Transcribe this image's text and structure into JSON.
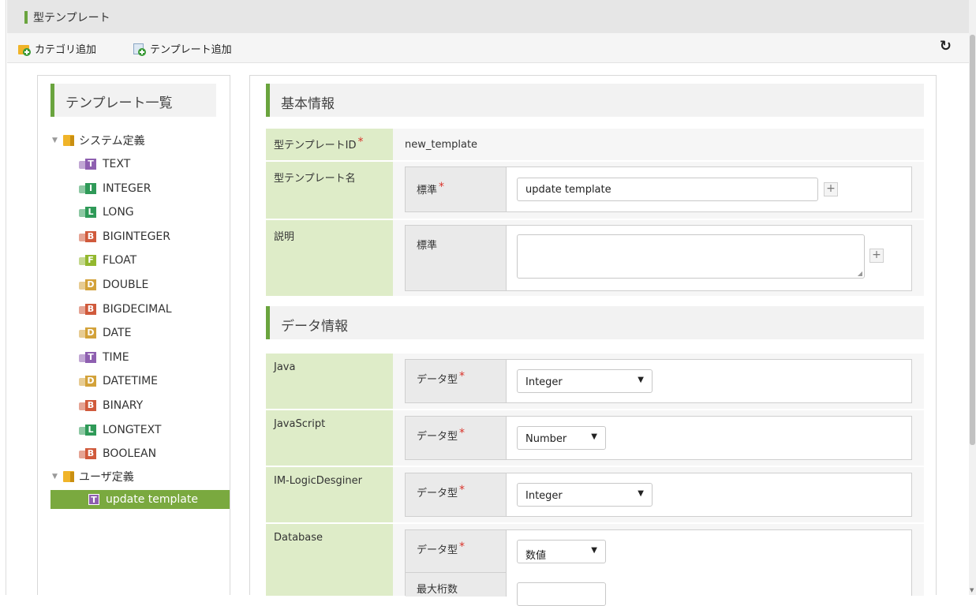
{
  "window": {
    "title": "型テンプレート"
  },
  "toolbar": {
    "add_category": "カテゴリ追加",
    "add_template": "テンプレート追加",
    "refresh_icon": "refresh-icon"
  },
  "tree": {
    "heading": "テンプレート一覧",
    "system_folder": "システム定義",
    "user_folder": "ユーザ定義",
    "items": [
      {
        "badge": "T",
        "label": "TEXT",
        "color": "#8e5fb0"
      },
      {
        "badge": "I",
        "label": "INTEGER",
        "color": "#2f9a58"
      },
      {
        "badge": "L",
        "label": "LONG",
        "color": "#2f9a58"
      },
      {
        "badge": "B",
        "label": "BIGINTEGER",
        "color": "#d05a3c"
      },
      {
        "badge": "F",
        "label": "FLOAT",
        "color": "#93b82f"
      },
      {
        "badge": "D",
        "label": "DOUBLE",
        "color": "#d3a23a"
      },
      {
        "badge": "B",
        "label": "BIGDECIMAL",
        "color": "#d05a3c"
      },
      {
        "badge": "D",
        "label": "DATE",
        "color": "#d3a23a"
      },
      {
        "badge": "T",
        "label": "TIME",
        "color": "#8e5fb0"
      },
      {
        "badge": "D",
        "label": "DATETIME",
        "color": "#d3a23a"
      },
      {
        "badge": "B",
        "label": "BINARY",
        "color": "#d05a3c"
      },
      {
        "badge": "L",
        "label": "LONGTEXT",
        "color": "#2f9a58"
      },
      {
        "badge": "B",
        "label": "BOOLEAN",
        "color": "#d05a3c"
      }
    ],
    "user_items": [
      {
        "badge": "T",
        "label": "update template"
      }
    ]
  },
  "form": {
    "basic_section": "基本情報",
    "data_section": "データ情報",
    "required_mark": "*",
    "id": {
      "label": "型テンプレートID",
      "value": "new_template"
    },
    "name": {
      "label": "型テンプレート名",
      "locale_label": "標準",
      "value": "update template"
    },
    "description": {
      "label": "説明",
      "locale_label": "標準",
      "value": ""
    },
    "plus_icon": "+",
    "java": {
      "label": "Java",
      "field_label": "データ型",
      "value": "Integer"
    },
    "javascript": {
      "label": "JavaScript",
      "field_label": "データ型",
      "value": "Number"
    },
    "logic_designer": {
      "label": "IM-LogicDesginer",
      "field_label": "データ型",
      "value": "Integer"
    },
    "database": {
      "label": "Database",
      "field_label": "データ型",
      "value": "数値",
      "max_digits_label": "最大桁数"
    }
  },
  "colors": {
    "accent": "#6aa43e",
    "label_bg": "#deecc8",
    "required": "#d9342b"
  }
}
